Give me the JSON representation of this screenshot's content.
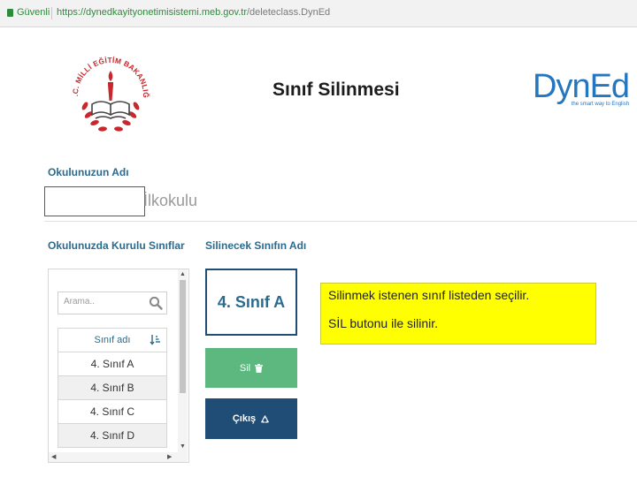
{
  "browser": {
    "secure_label": "Güvenli",
    "url_host": "https://dynedkayityonetimisistemi.meb.gov.tr",
    "url_path": "/deleteclass.DynEd"
  },
  "header": {
    "title": "Sınıf Silinmesi",
    "seal_text": "T.C. MİLLİ EĞİTİM BAKANLIĞI",
    "brand_logo": "DynEd",
    "brand_tagline": "the smart way to English"
  },
  "school": {
    "label": "Okulunuzun Adı",
    "name_suffix": "İlkokulu"
  },
  "classes": {
    "label": "Okulunuzda Kurulu Sınıflar",
    "search_placeholder": "Arama..",
    "column_header": "Sınıf adı",
    "rows": [
      "4. Sınıf A",
      "4. Sınıf B",
      "4. Sınıf C",
      "4. Sınıf D"
    ]
  },
  "delete_panel": {
    "label": "Silinecek Sınıfın Adı",
    "selected_class": "4. Sınıf A",
    "delete_button": "Sil",
    "exit_button": "Çıkış"
  },
  "callout": {
    "line1": "Silinmek istenen sınıf listeden seçilir.",
    "line2": "SİL butonu ile silinir."
  },
  "colors": {
    "accent": "#2a6b8f",
    "delete_green": "#5cb87e",
    "exit_navy": "#1f4d76",
    "callout_yellow": "#ffff00",
    "seal_red": "#c8282d",
    "brand_blue": "#2476c0"
  },
  "icons": {
    "search": "search-icon",
    "sort": "sort-icon",
    "trash": "trash-icon",
    "recycle": "recycle-icon",
    "lock": "lock-icon"
  }
}
